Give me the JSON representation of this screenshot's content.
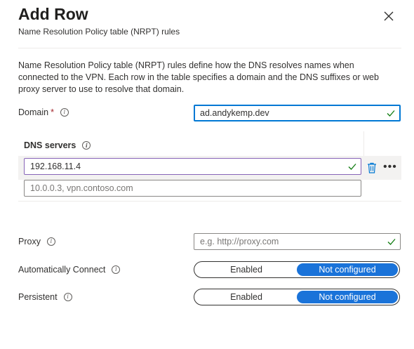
{
  "panel": {
    "title": "Add Row",
    "subtitle": "Name Resolution Policy table (NRPT) rules",
    "description": "Name Resolution Policy table (NRPT) rules define how the DNS resolves names when connected to the VPN. Each row in the table specifies a domain and the DNS suffixes or web proxy server to use to resolve that domain."
  },
  "domain": {
    "label": "Domain",
    "required_mark": "*",
    "value": "ad.andykemp.dev"
  },
  "dns_servers": {
    "header": "DNS servers",
    "rows": [
      {
        "value": "192.168.11.4"
      }
    ],
    "new_row_placeholder": "10.0.0.3, vpn.contoso.com",
    "more_label": "•••"
  },
  "proxy": {
    "label": "Proxy",
    "placeholder": "e.g. http://proxy.com"
  },
  "auto_connect": {
    "label": "Automatically Connect",
    "options": [
      "Enabled",
      "Not configured"
    ],
    "selected": "Not configured"
  },
  "persistent": {
    "label": "Persistent",
    "options": [
      "Enabled",
      "Not configured"
    ],
    "selected": "Not configured"
  },
  "colors": {
    "accent": "#1a73d9",
    "focus_border": "#0078d4",
    "valid_check": "#107c10",
    "required": "#a4262c"
  }
}
